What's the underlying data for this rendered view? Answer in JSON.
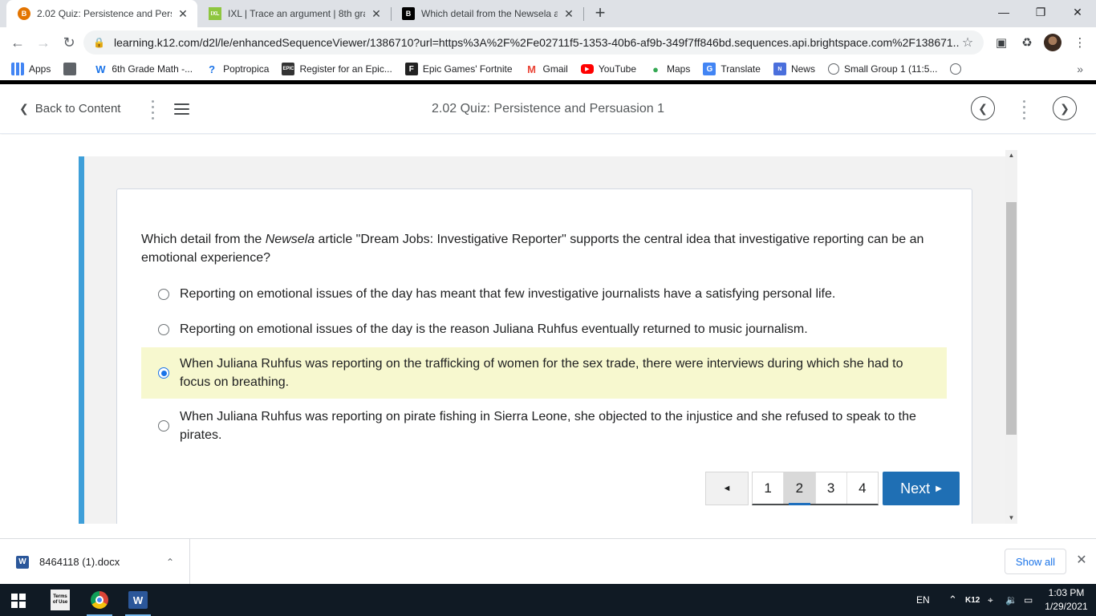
{
  "browser": {
    "tabs": [
      {
        "title": "2.02 Quiz: Persistence and Persua",
        "favicon": "b-badge-icon",
        "active": true
      },
      {
        "title": "IXL | Trace an argument | 8th grad",
        "favicon": "ixl-icon",
        "active": false
      },
      {
        "title": "Which detail from the Newsela ar",
        "favicon": "brainly-icon",
        "active": false
      }
    ],
    "url": "learning.k12.com/d2l/le/enhancedSequenceViewer/1386710?url=https%3A%2F%2Fe02711f5-1353-40b6-af9b-349f7ff846bd.sequences.api.brightspace.com%2F138671...",
    "bookmarks": [
      {
        "label": "Apps",
        "icon": "apps-grid-icon"
      },
      {
        "label": "",
        "icon": "folder-icon"
      },
      {
        "label": "6th Grade Math -...",
        "icon": "w-icon"
      },
      {
        "label": "Poptropica",
        "icon": "poptropica-icon"
      },
      {
        "label": "Register for an Epic...",
        "icon": "epic-icon"
      },
      {
        "label": "Epic Games' Fortnite",
        "icon": "f-icon"
      },
      {
        "label": "Gmail",
        "icon": "gmail-icon"
      },
      {
        "label": "YouTube",
        "icon": "youtube-icon"
      },
      {
        "label": "Maps",
        "icon": "maps-icon"
      },
      {
        "label": "Translate",
        "icon": "translate-icon"
      },
      {
        "label": "News",
        "icon": "news-icon"
      },
      {
        "label": "Small Group 1 (11:5...",
        "icon": "globe-icon"
      },
      {
        "label": "",
        "icon": "globe-icon"
      }
    ]
  },
  "header": {
    "back_label": "Back to Content",
    "title": "2.02 Quiz: Persistence and Persuasion 1"
  },
  "quiz": {
    "question_prefix": "Which detail from the ",
    "question_italic": "Newsela",
    "question_suffix": " article \"Dream Jobs: Investigative Reporter\" supports the central idea that investigative reporting can be an emotional experience?",
    "options": [
      {
        "label": "Reporting on emotional issues of the day has meant that few investigative journalists have a satisfying personal life.",
        "selected": false
      },
      {
        "label": "Reporting on emotional issues of the day is the reason Juliana Ruhfus eventually returned to music journalism.",
        "selected": false
      },
      {
        "label": "When Juliana Ruhfus was reporting on the trafficking of women for the sex trade, there were interviews during which she had to focus on breathing.",
        "selected": true
      },
      {
        "label": "When Juliana Ruhfus was reporting on pirate fishing in Sierra Leone, she objected to the injustice and she refused to speak to the pirates.",
        "selected": false
      }
    ],
    "pagination": {
      "prev_symbol": "◄",
      "pages": [
        "1",
        "2",
        "3",
        "4"
      ],
      "current": "2",
      "next_label": "Next"
    }
  },
  "downloads": {
    "filename": "8464118 (1).docx",
    "show_all": "Show all"
  },
  "taskbar": {
    "terms_label": "Terms of Use",
    "language": "EN",
    "tray_k12": "K12",
    "time": "1:03 PM",
    "date": "1/29/2021"
  },
  "colors": {
    "accent_blue": "#1f6fb4",
    "frame_stripe": "#3e9fd9",
    "selected_highlight": "#f7f8cf"
  }
}
